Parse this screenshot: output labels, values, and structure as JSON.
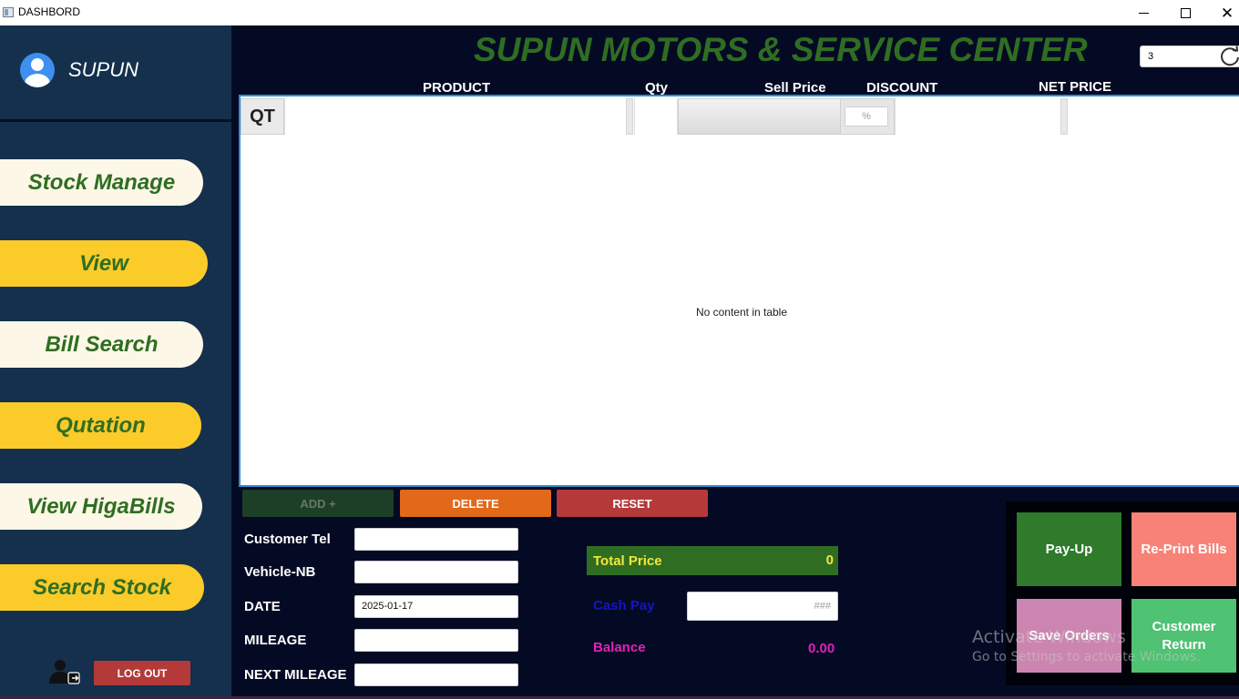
{
  "window": {
    "title": "DASHBORD"
  },
  "sidebar": {
    "user_name": "SUPUN",
    "nav": [
      {
        "label": "Stock Manage",
        "style": "cream"
      },
      {
        "label": "View",
        "style": "yellow"
      },
      {
        "label": "Bill Search",
        "style": "cream"
      },
      {
        "label": "Qutation",
        "style": "yellow"
      },
      {
        "label": "View HigaBills",
        "style": "cream"
      },
      {
        "label": "Search Stock",
        "style": "yellow"
      }
    ],
    "logout_label": "LOG OUT"
  },
  "header": {
    "shop_title": "SUPUN MOTORS & SERVICE CENTER",
    "bill_number": "3"
  },
  "table": {
    "columns": [
      "PRODUCT",
      "Qty",
      "Sell Price",
      "DISCOUNT",
      "NET PRICE"
    ],
    "qt_button": "QT",
    "discount_placeholder": "%",
    "empty_message": "No content in table",
    "rows": []
  },
  "actions": {
    "add": "ADD +",
    "delete": "DELETE",
    "reset": "RESET"
  },
  "customer_form": {
    "customer_tel_label": "Customer Tel",
    "customer_tel_value": "",
    "vehicle_label": "Vehicle-NB",
    "vehicle_value": "",
    "date_label": "DATE",
    "date_value": "2025-01-17",
    "mileage_label": "MILEAGE",
    "mileage_value": "",
    "next_mileage_label": "NEXT MILEAGE",
    "next_mileage_value": ""
  },
  "totals": {
    "total_label": "Total Price",
    "total_value": "0",
    "cash_label": "Cash Pay",
    "cash_placeholder": "###",
    "balance_label": "Balance",
    "balance_value": "0.00"
  },
  "payment": {
    "payup": "Pay-Up",
    "reprint": "Re-Print Bills",
    "save_orders": "Save Orders",
    "customer_return": "Customer Return"
  },
  "watermark": {
    "line1": "Activate Windows",
    "line2": "Go to Settings to activate Windows."
  },
  "colors": {
    "sidebar_bg": "#14304d",
    "main_bg": "#050a24",
    "brand_green": "#2f6e22",
    "nav_yellow": "#fbcb2a",
    "nav_cream": "#fdf7e7"
  }
}
